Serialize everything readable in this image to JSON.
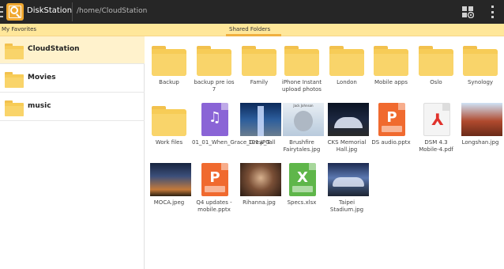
{
  "app": {
    "title": "DiskStation",
    "path": "/home/CloudStation"
  },
  "tabs": {
    "favorites": "My Favorites",
    "shared": "Shared Folders"
  },
  "sidebar": {
    "items": [
      {
        "label": "CloudStation",
        "selected": true
      },
      {
        "label": "Movies",
        "selected": false
      },
      {
        "label": "music",
        "selected": false
      }
    ]
  },
  "grid": {
    "items": [
      {
        "name": "Backup",
        "kind": "folder"
      },
      {
        "name": "backup pre ios 7",
        "kind": "folder"
      },
      {
        "name": "Family",
        "kind": "folder"
      },
      {
        "name": "iPhone Instant upload photos",
        "kind": "folder"
      },
      {
        "name": "London",
        "kind": "folder"
      },
      {
        "name": "Mobile apps",
        "kind": "folder"
      },
      {
        "name": "Oslo",
        "kind": "folder"
      },
      {
        "name": "Synology",
        "kind": "folder"
      },
      {
        "name": "Work files",
        "kind": "folder"
      },
      {
        "name": "01_01_When_Grace_Grew_Tall",
        "kind": "music"
      },
      {
        "name": "101.JPG",
        "kind": "photo"
      },
      {
        "name": "Brushfire Fairytales.jpg",
        "kind": "photo"
      },
      {
        "name": "CKS Memorial Hall.jpg",
        "kind": "photo"
      },
      {
        "name": "DS audio.pptx",
        "kind": "pptx"
      },
      {
        "name": "DSM 4.3 Mobile-4.pdf",
        "kind": "pdf"
      },
      {
        "name": "Longshan.jpg",
        "kind": "photo"
      },
      {
        "name": "MOCA.jpeg",
        "kind": "photo"
      },
      {
        "name": "Q4 updates - mobile.pptx",
        "kind": "pptx"
      },
      {
        "name": "Rihanna.jpg",
        "kind": "photo"
      },
      {
        "name": "Specs.xlsx",
        "kind": "xlsx"
      },
      {
        "name": "Taipei Stadium.jpg",
        "kind": "photo"
      }
    ],
    "photo_caption_brush": "Jack Johnson"
  },
  "icons": {
    "logo": "disk-station-logo-icon",
    "view_toggle": "grid-view-icon",
    "overflow": "overflow-menu-icon"
  },
  "colors": {
    "actionbar": "#262626",
    "tabstrip": "#ffe79a",
    "accent": "#f0b040",
    "selected_row": "#fff2cc",
    "folder": "#f7cc57"
  }
}
